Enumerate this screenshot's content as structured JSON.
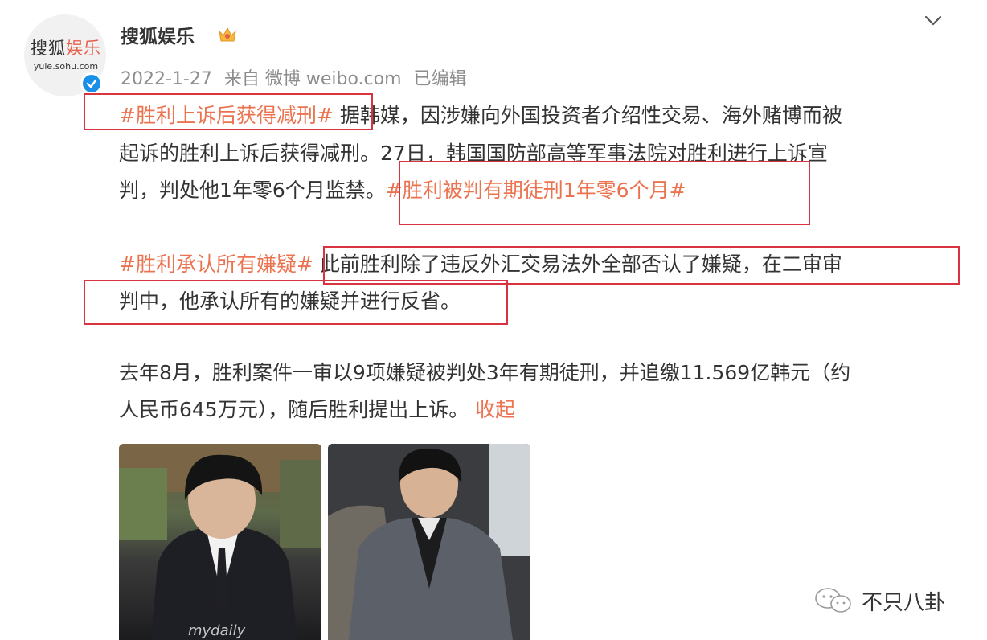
{
  "avatar": {
    "logo_cn_a": "搜狐",
    "logo_cn_b": "娱乐",
    "logo_url": "yule.sohu.com"
  },
  "header": {
    "name": "搜狐娱乐",
    "date": "2022-1-27",
    "source": "来自 微博 weibo.com",
    "edited": "已编辑"
  },
  "post": {
    "topic1": "#胜利上诉后获得减刑#",
    "line1_rest": " 据韩媒，因涉嫌向外国投资者介绍性交易、海外赌博而被",
    "line2": "起诉的胜利上诉后获得减刑。27日，韩国国防部高等军事法院对胜利进行上诉宣",
    "line3_pre": "判，判处他1年零6个月监禁。",
    "topic2": "#胜利被判有期徒刑1年零6个月#",
    "topic3": "#胜利承认所有嫌疑#",
    "line4_rest": " 此前胜利除了违反外汇交易法外全部否认了嫌疑，在二审审",
    "line5": "判中，他承认所有的嫌疑并进行反省。",
    "line6": "去年8月，胜利案件一审以9项嫌疑被判处3年有期徒刑，并追缴11.569亿韩元（约",
    "line7_pre": "人民币645万元），随后胜利提出上诉。",
    "collapse": "收起"
  },
  "photos": {
    "watermark": "mydaily"
  },
  "corner_watermark": "不只八卦",
  "colors": {
    "topic": "#eb7350",
    "highlight_box": "#d9333f",
    "meta": "#8d8d8d",
    "verified": "#1a8fe8"
  }
}
